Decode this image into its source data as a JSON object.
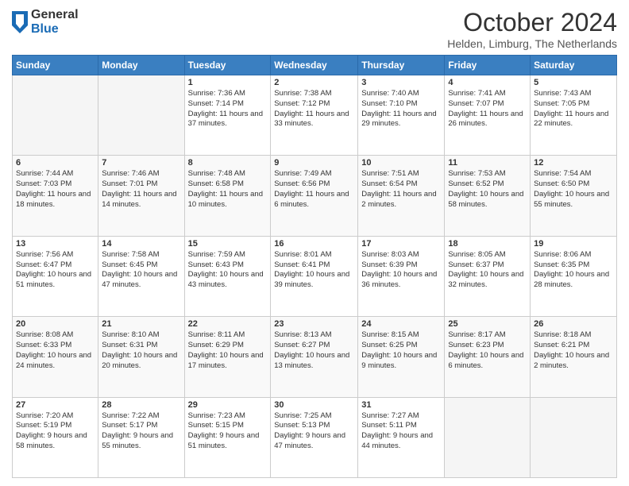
{
  "header": {
    "logo": {
      "general": "General",
      "blue": "Blue"
    },
    "title": "October 2024",
    "location": "Helden, Limburg, The Netherlands"
  },
  "weekdays": [
    "Sunday",
    "Monday",
    "Tuesday",
    "Wednesday",
    "Thursday",
    "Friday",
    "Saturday"
  ],
  "weeks": [
    [
      {
        "day": "",
        "sunrise": "",
        "sunset": "",
        "daylight": ""
      },
      {
        "day": "",
        "sunrise": "",
        "sunset": "",
        "daylight": ""
      },
      {
        "day": "1",
        "sunrise": "Sunrise: 7:36 AM",
        "sunset": "Sunset: 7:14 PM",
        "daylight": "Daylight: 11 hours and 37 minutes."
      },
      {
        "day": "2",
        "sunrise": "Sunrise: 7:38 AM",
        "sunset": "Sunset: 7:12 PM",
        "daylight": "Daylight: 11 hours and 33 minutes."
      },
      {
        "day": "3",
        "sunrise": "Sunrise: 7:40 AM",
        "sunset": "Sunset: 7:10 PM",
        "daylight": "Daylight: 11 hours and 29 minutes."
      },
      {
        "day": "4",
        "sunrise": "Sunrise: 7:41 AM",
        "sunset": "Sunset: 7:07 PM",
        "daylight": "Daylight: 11 hours and 26 minutes."
      },
      {
        "day": "5",
        "sunrise": "Sunrise: 7:43 AM",
        "sunset": "Sunset: 7:05 PM",
        "daylight": "Daylight: 11 hours and 22 minutes."
      }
    ],
    [
      {
        "day": "6",
        "sunrise": "Sunrise: 7:44 AM",
        "sunset": "Sunset: 7:03 PM",
        "daylight": "Daylight: 11 hours and 18 minutes."
      },
      {
        "day": "7",
        "sunrise": "Sunrise: 7:46 AM",
        "sunset": "Sunset: 7:01 PM",
        "daylight": "Daylight: 11 hours and 14 minutes."
      },
      {
        "day": "8",
        "sunrise": "Sunrise: 7:48 AM",
        "sunset": "Sunset: 6:58 PM",
        "daylight": "Daylight: 11 hours and 10 minutes."
      },
      {
        "day": "9",
        "sunrise": "Sunrise: 7:49 AM",
        "sunset": "Sunset: 6:56 PM",
        "daylight": "Daylight: 11 hours and 6 minutes."
      },
      {
        "day": "10",
        "sunrise": "Sunrise: 7:51 AM",
        "sunset": "Sunset: 6:54 PM",
        "daylight": "Daylight: 11 hours and 2 minutes."
      },
      {
        "day": "11",
        "sunrise": "Sunrise: 7:53 AM",
        "sunset": "Sunset: 6:52 PM",
        "daylight": "Daylight: 10 hours and 58 minutes."
      },
      {
        "day": "12",
        "sunrise": "Sunrise: 7:54 AM",
        "sunset": "Sunset: 6:50 PM",
        "daylight": "Daylight: 10 hours and 55 minutes."
      }
    ],
    [
      {
        "day": "13",
        "sunrise": "Sunrise: 7:56 AM",
        "sunset": "Sunset: 6:47 PM",
        "daylight": "Daylight: 10 hours and 51 minutes."
      },
      {
        "day": "14",
        "sunrise": "Sunrise: 7:58 AM",
        "sunset": "Sunset: 6:45 PM",
        "daylight": "Daylight: 10 hours and 47 minutes."
      },
      {
        "day": "15",
        "sunrise": "Sunrise: 7:59 AM",
        "sunset": "Sunset: 6:43 PM",
        "daylight": "Daylight: 10 hours and 43 minutes."
      },
      {
        "day": "16",
        "sunrise": "Sunrise: 8:01 AM",
        "sunset": "Sunset: 6:41 PM",
        "daylight": "Daylight: 10 hours and 39 minutes."
      },
      {
        "day": "17",
        "sunrise": "Sunrise: 8:03 AM",
        "sunset": "Sunset: 6:39 PM",
        "daylight": "Daylight: 10 hours and 36 minutes."
      },
      {
        "day": "18",
        "sunrise": "Sunrise: 8:05 AM",
        "sunset": "Sunset: 6:37 PM",
        "daylight": "Daylight: 10 hours and 32 minutes."
      },
      {
        "day": "19",
        "sunrise": "Sunrise: 8:06 AM",
        "sunset": "Sunset: 6:35 PM",
        "daylight": "Daylight: 10 hours and 28 minutes."
      }
    ],
    [
      {
        "day": "20",
        "sunrise": "Sunrise: 8:08 AM",
        "sunset": "Sunset: 6:33 PM",
        "daylight": "Daylight: 10 hours and 24 minutes."
      },
      {
        "day": "21",
        "sunrise": "Sunrise: 8:10 AM",
        "sunset": "Sunset: 6:31 PM",
        "daylight": "Daylight: 10 hours and 20 minutes."
      },
      {
        "day": "22",
        "sunrise": "Sunrise: 8:11 AM",
        "sunset": "Sunset: 6:29 PM",
        "daylight": "Daylight: 10 hours and 17 minutes."
      },
      {
        "day": "23",
        "sunrise": "Sunrise: 8:13 AM",
        "sunset": "Sunset: 6:27 PM",
        "daylight": "Daylight: 10 hours and 13 minutes."
      },
      {
        "day": "24",
        "sunrise": "Sunrise: 8:15 AM",
        "sunset": "Sunset: 6:25 PM",
        "daylight": "Daylight: 10 hours and 9 minutes."
      },
      {
        "day": "25",
        "sunrise": "Sunrise: 8:17 AM",
        "sunset": "Sunset: 6:23 PM",
        "daylight": "Daylight: 10 hours and 6 minutes."
      },
      {
        "day": "26",
        "sunrise": "Sunrise: 8:18 AM",
        "sunset": "Sunset: 6:21 PM",
        "daylight": "Daylight: 10 hours and 2 minutes."
      }
    ],
    [
      {
        "day": "27",
        "sunrise": "Sunrise: 7:20 AM",
        "sunset": "Sunset: 5:19 PM",
        "daylight": "Daylight: 9 hours and 58 minutes."
      },
      {
        "day": "28",
        "sunrise": "Sunrise: 7:22 AM",
        "sunset": "Sunset: 5:17 PM",
        "daylight": "Daylight: 9 hours and 55 minutes."
      },
      {
        "day": "29",
        "sunrise": "Sunrise: 7:23 AM",
        "sunset": "Sunset: 5:15 PM",
        "daylight": "Daylight: 9 hours and 51 minutes."
      },
      {
        "day": "30",
        "sunrise": "Sunrise: 7:25 AM",
        "sunset": "Sunset: 5:13 PM",
        "daylight": "Daylight: 9 hours and 47 minutes."
      },
      {
        "day": "31",
        "sunrise": "Sunrise: 7:27 AM",
        "sunset": "Sunset: 5:11 PM",
        "daylight": "Daylight: 9 hours and 44 minutes."
      },
      {
        "day": "",
        "sunrise": "",
        "sunset": "",
        "daylight": ""
      },
      {
        "day": "",
        "sunrise": "",
        "sunset": "",
        "daylight": ""
      }
    ]
  ]
}
